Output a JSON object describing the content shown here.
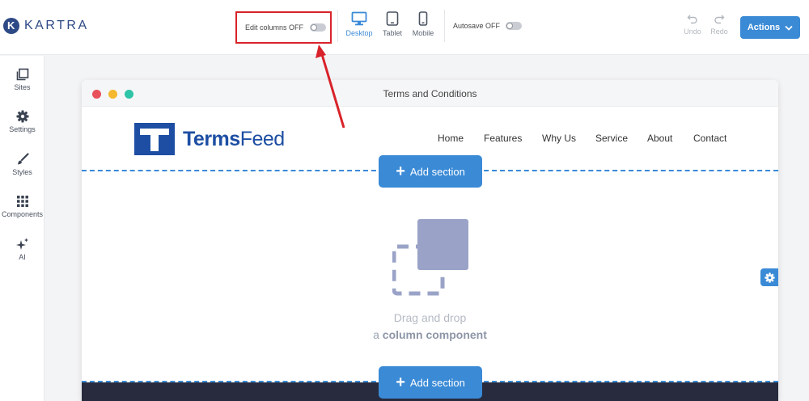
{
  "app": {
    "brand": "KARTRA"
  },
  "toolbar": {
    "edit_columns_label": "Edit columns OFF",
    "devices": [
      {
        "label": "Desktop",
        "icon": "desktop-icon",
        "active": true
      },
      {
        "label": "Tablet",
        "icon": "tablet-icon",
        "active": false
      },
      {
        "label": "Mobile",
        "icon": "mobile-icon",
        "active": false
      }
    ],
    "autosave_label": "Autosave OFF",
    "undo_label": "Undo",
    "redo_label": "Redo",
    "actions_label": "Actions"
  },
  "sidebar": {
    "items": [
      {
        "label": "Sites",
        "icon": "sites-icon"
      },
      {
        "label": "Settings",
        "icon": "gear-icon"
      },
      {
        "label": "Styles",
        "icon": "brush-icon"
      },
      {
        "label": "Components",
        "icon": "grid-icon"
      },
      {
        "label": "AI",
        "icon": "sparkle-icon"
      }
    ]
  },
  "canvas": {
    "window_title": "Terms and Conditions",
    "site_logo": {
      "prefix": "Terms",
      "suffix": "Feed"
    },
    "nav": [
      "Home",
      "Features",
      "Why Us",
      "Service",
      "About",
      "Contact"
    ],
    "add_section_label": "Add section",
    "dropzone_line1": "Drag and drop",
    "dropzone_line2_prefix": "a",
    "dropzone_line2_bold": "column component"
  },
  "colors": {
    "accent": "#3a8ad6",
    "brand": "#2e4a86",
    "termsfeed_blue": "#1d4ea3",
    "highlight_red": "#d8232a",
    "footer_dark": "#272b3d"
  }
}
